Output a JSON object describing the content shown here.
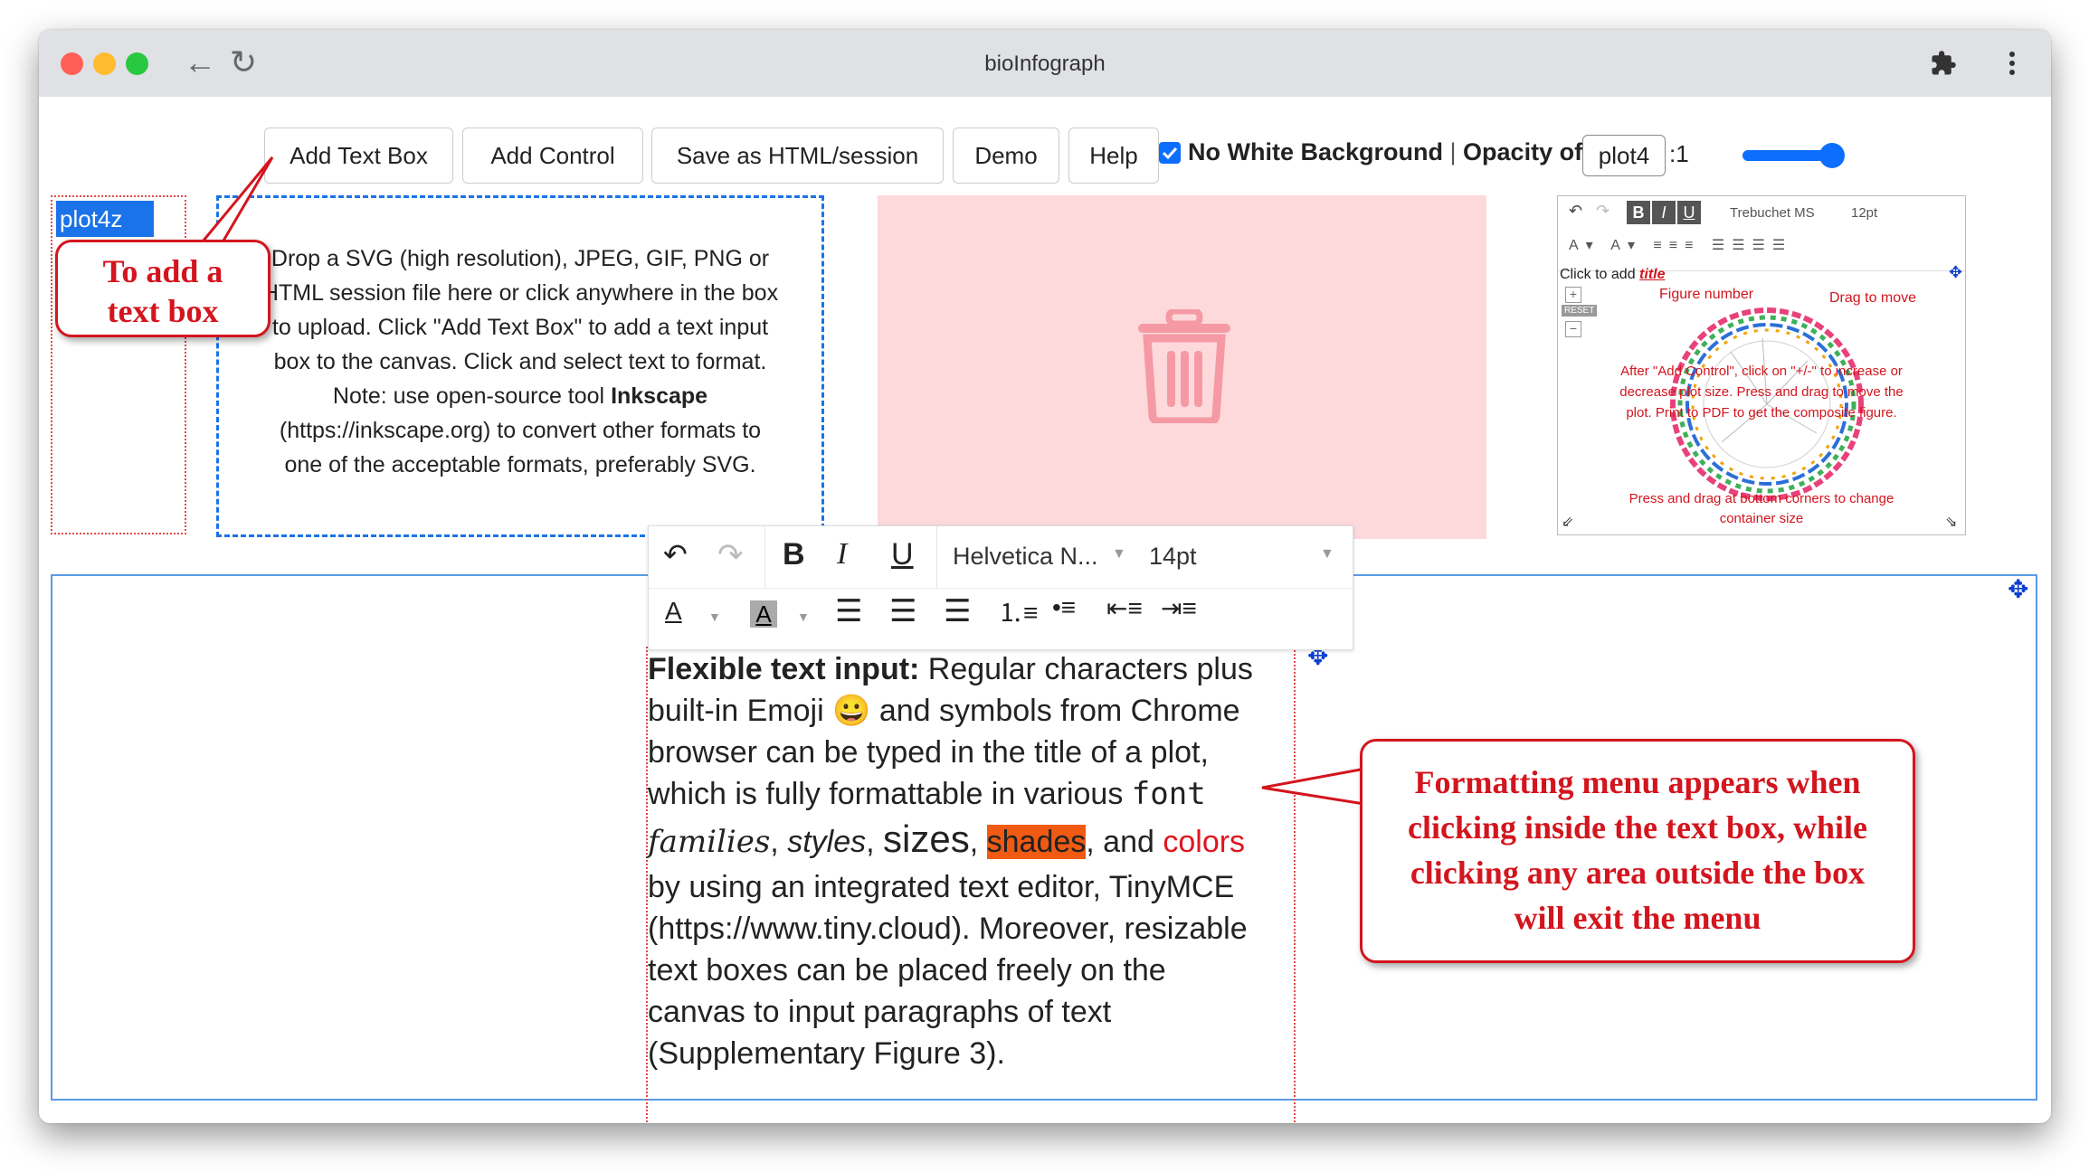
{
  "window": {
    "title": "bioInfograph"
  },
  "toolbar": {
    "add_text_box": "Add Text Box",
    "add_control": "Add Control",
    "save_html": "Save as HTML/session",
    "demo": "Demo",
    "help": "Help",
    "no_white_bg_label": "No White Background",
    "separator": "|",
    "opacity_label": "Opacity of",
    "opacity_target": "plot4",
    "opacity_suffix": ":1",
    "opacity_value": 0.9
  },
  "plot_label": "plot4z",
  "dropzone": {
    "line1": "Drop a SVG (high resolution), JPEG, GIF, PNG or",
    "line2": "HTML session file here or click anywhere in the box",
    "line3": "to upload. Click \"Add Text Box\" to add a text input",
    "line4": "box to the canvas. Click and select text to format.",
    "line5_pre": "Note: use open-source tool ",
    "line5_bold": "Inkscape",
    "line6": "(https://inkscape.org) to convert other formats to",
    "line7": "one of the acceptable formats, preferably SVG."
  },
  "callout_add": {
    "line1": "To add a",
    "line2": "text box"
  },
  "callout_format": {
    "line1": "Formatting menu appears when",
    "line2": "clicking inside the text box, while",
    "line3": "clicking any area outside the box",
    "line4": "will exit the menu"
  },
  "editor": {
    "font": "Helvetica N...",
    "size": "14pt",
    "text": {
      "bold_lead": "Flexible text input:",
      "p1": " Regular characters plus",
      "p2": "built-in Emoji ",
      "emoji": "😀",
      "p2b": " and symbols from Chrome",
      "p3": "browser can be typed in the title of a plot,",
      "p4": "which is fully formattable in various ",
      "font_word": "font",
      "families": "families",
      "comma1": ", ",
      "styles": "styles",
      "comma2": ", ",
      "sizes": "sizes",
      "comma3": ", ",
      "shades": "shades",
      "and": ", and ",
      "colors": "colors",
      "p6": "by using an integrated text editor, TinyMCE",
      "p7": "(https://www.tiny.cloud). Moreover, resizable",
      "p8": "text boxes can be placed freely on the",
      "p9": "canvas to input paragraphs of text",
      "p10": "(Supplementary Figure 3)."
    }
  },
  "thumb": {
    "font": "Trebuchet MS",
    "size": "12pt",
    "click_to_add": "Click to add ",
    "title_word": "title",
    "reset": "RESET",
    "figure_number": "Figure number",
    "drag_to_move": "Drag to move",
    "note1": "After \"Add Control\", click on \"+/-\" to increase or",
    "note2": "decrease plot size. Press and drag to move the",
    "note3": "plot. Print to PDF to get the composite figure.",
    "note4": "Press and drag at bottom corners to change",
    "note5": "container size"
  },
  "colors": {
    "accent_blue": "#0d6efd",
    "callout_red": "#d3151e",
    "trash_pink": "#fdd9dc",
    "shade_orange": "#f05a12"
  }
}
